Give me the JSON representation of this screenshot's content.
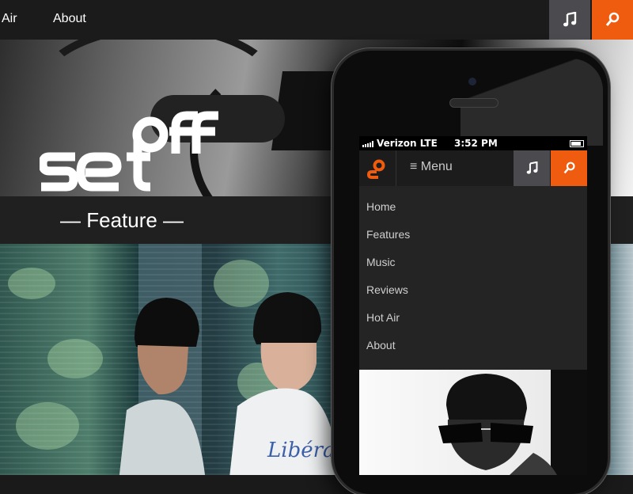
{
  "topnav": {
    "links": [
      "Air",
      "About"
    ],
    "music_icon": "music-note-icon",
    "search_icon": "search-icon"
  },
  "hero": {
    "logo_text": "set off"
  },
  "feature": {
    "title": "— Feature —"
  },
  "phone": {
    "status": {
      "carrier": "Verizon LTE",
      "time": "3:52 PM"
    },
    "header": {
      "menu_label": "≡ Menu"
    },
    "menu_items": [
      "Home",
      "Features",
      "Music",
      "Reviews",
      "Hot Air",
      "About"
    ]
  },
  "colors": {
    "accent": "#ef5b0f",
    "music_button": "#4a4a4f",
    "nav_bg": "#1b1b1b"
  }
}
